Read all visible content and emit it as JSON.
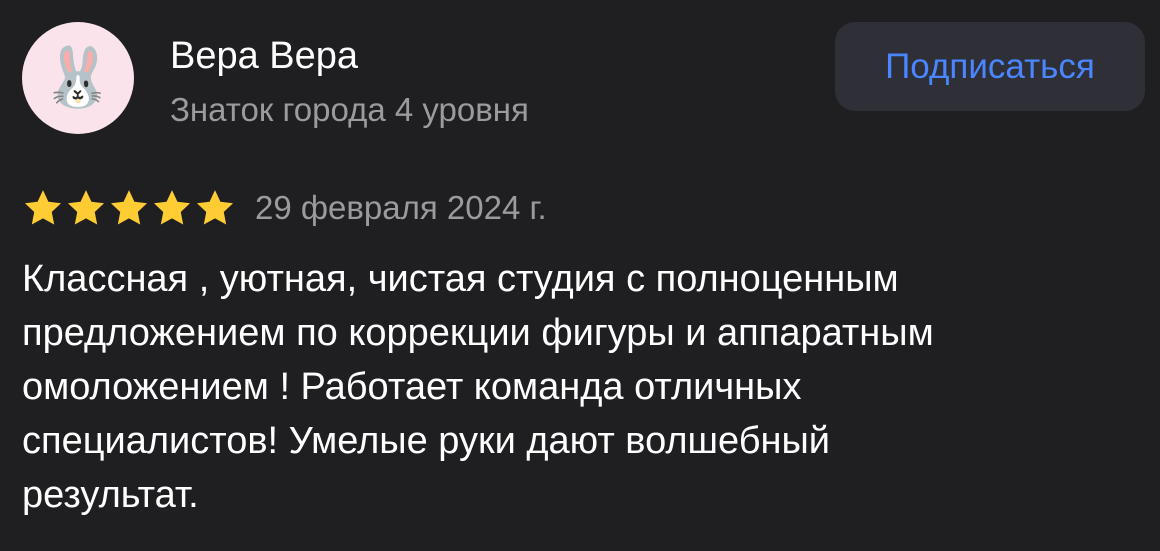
{
  "author": {
    "name": "Вера Вера",
    "level": "Знаток города 4 уровня",
    "avatar_emoji": "🐰",
    "avatar_icon": "rabbit-face-icon"
  },
  "subscribe_button": {
    "label": "Подписаться"
  },
  "review": {
    "rating": 5,
    "rating_max": 5,
    "date": "29 февраля 2024 г.",
    "text": "Классная , уютная, чистая студия с полноценным\nпредложением по коррекции фигуры и аппаратным\nомоложением ! Работает команда отличных\nспециалистов! Умелые руки дают волшебный\nрезультат."
  },
  "colors": {
    "background": "#1f1f22",
    "star": "#ffcc33",
    "accent": "#4a86ff",
    "secondary_text": "#9a9a9f",
    "button_bg": "#2e2f37",
    "avatar_bg": "#fbe3ec"
  }
}
